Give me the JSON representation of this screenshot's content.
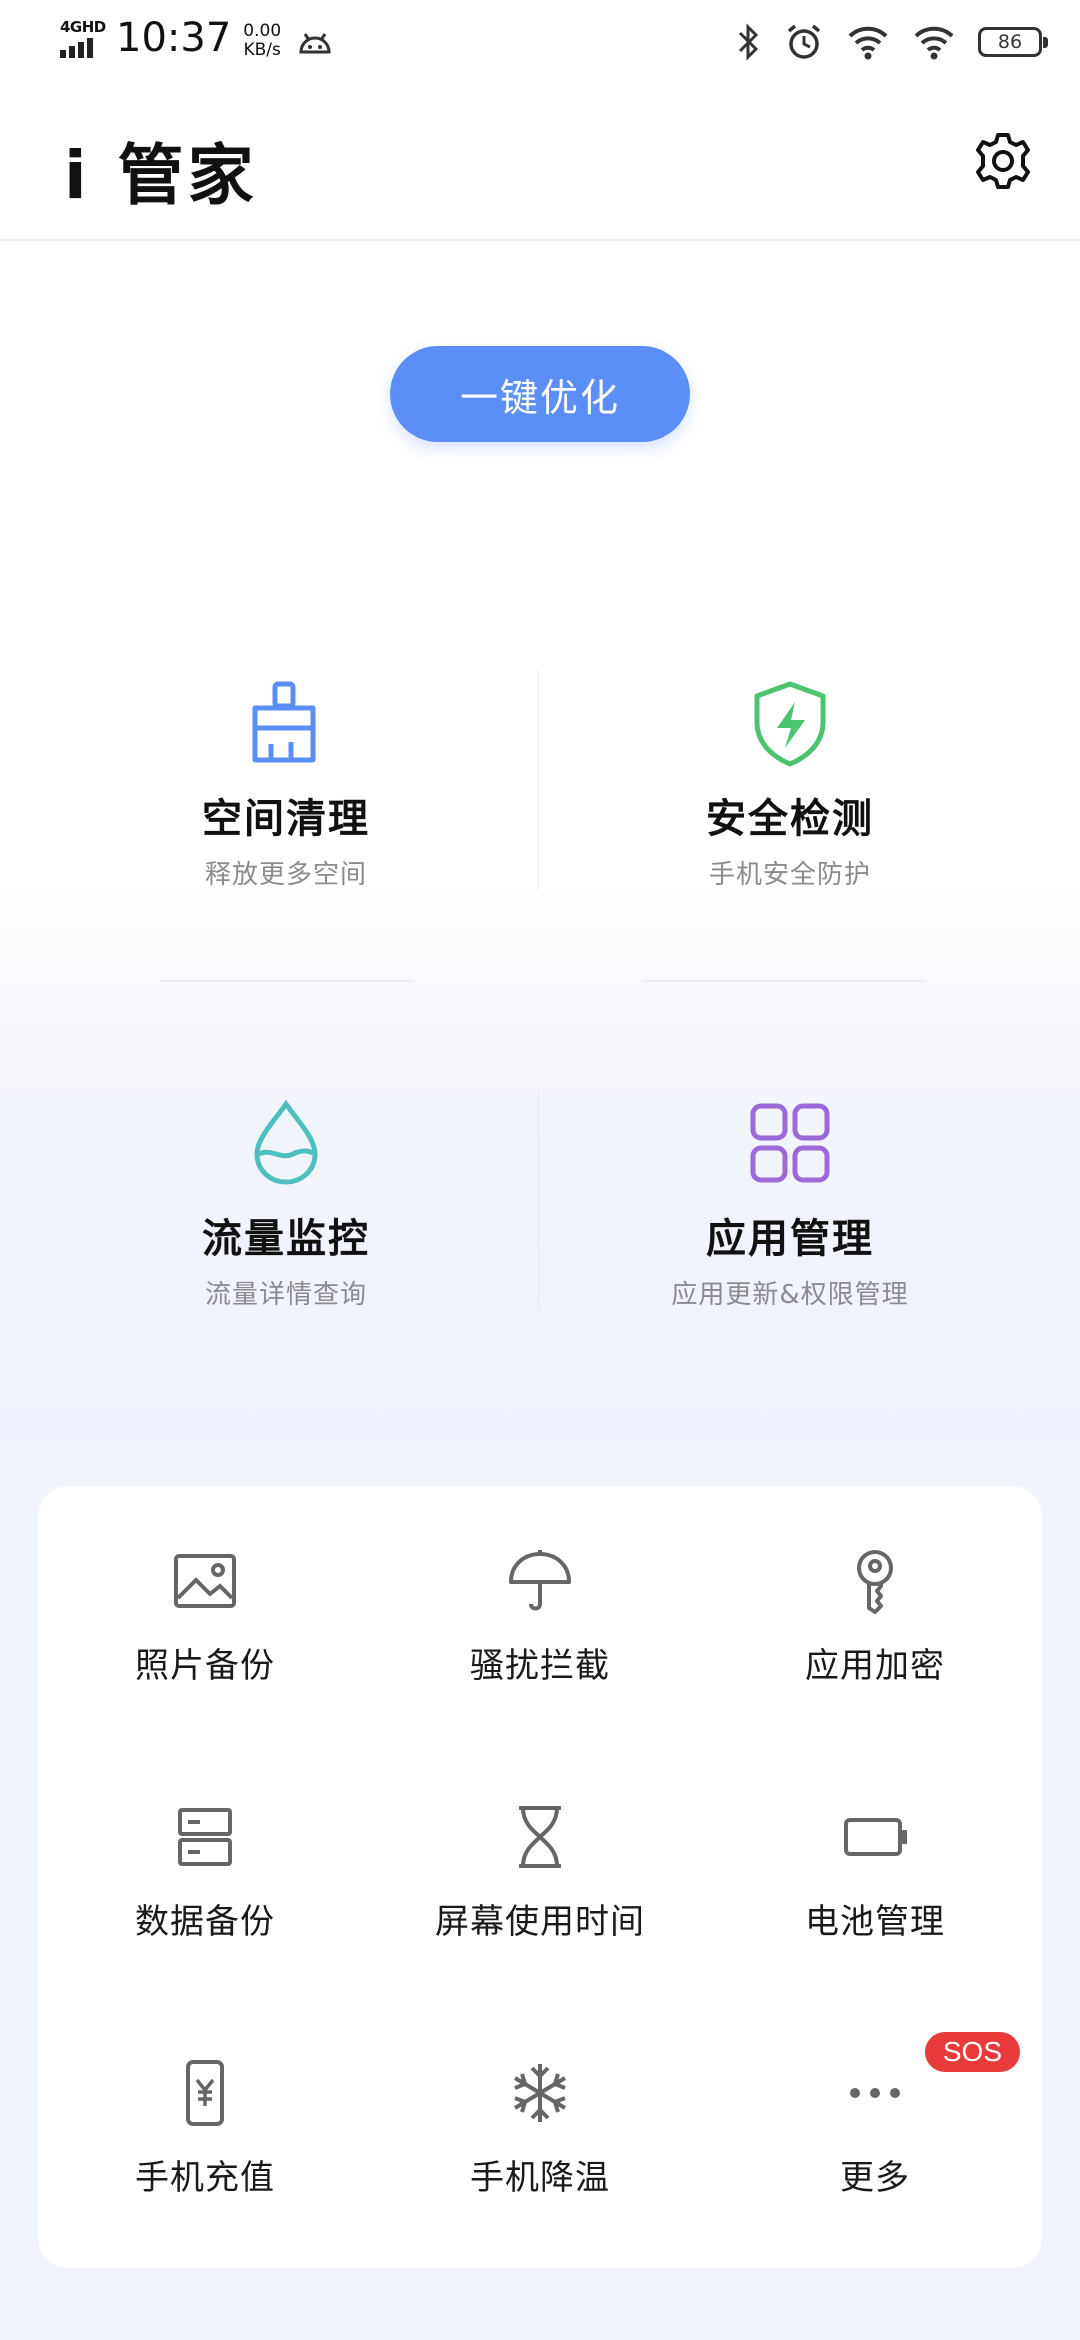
{
  "status_bar": {
    "network": "4GHD",
    "time": "10:37",
    "speed_value": "0.00",
    "speed_unit": "KB/s",
    "battery": "86"
  },
  "header": {
    "title": "i 管家"
  },
  "optimize_button": "一键优化",
  "features": [
    {
      "title": "空间清理",
      "subtitle": "释放更多空间",
      "icon": "broom-icon"
    },
    {
      "title": "安全检测",
      "subtitle": "手机安全防护",
      "icon": "shield-bolt-icon"
    },
    {
      "title": "流量监控",
      "subtitle": "流量详情查询",
      "icon": "water-drop-icon"
    },
    {
      "title": "应用管理",
      "subtitle": "应用更新&权限管理",
      "icon": "app-grid-icon"
    }
  ],
  "tools": [
    {
      "label": "照片备份",
      "icon": "photo-icon"
    },
    {
      "label": "骚扰拦截",
      "icon": "umbrella-icon"
    },
    {
      "label": "应用加密",
      "icon": "key-icon"
    },
    {
      "label": "数据备份",
      "icon": "storage-icon"
    },
    {
      "label": "屏幕使用时间",
      "icon": "hourglass-icon"
    },
    {
      "label": "电池管理",
      "icon": "battery-icon"
    },
    {
      "label": "手机充值",
      "icon": "phone-recharge-icon"
    },
    {
      "label": "手机降温",
      "icon": "snowflake-icon"
    },
    {
      "label": "更多",
      "icon": "more-icon",
      "badge": "SOS"
    }
  ],
  "colors": {
    "accent": "#5b8ef7",
    "clean_icon": "#5b8ef7",
    "security_icon": "#4cc46e",
    "traffic_icon": "#4cc0c0",
    "apps_icon": "#9a6bd8",
    "badge": "#e83a3a"
  }
}
